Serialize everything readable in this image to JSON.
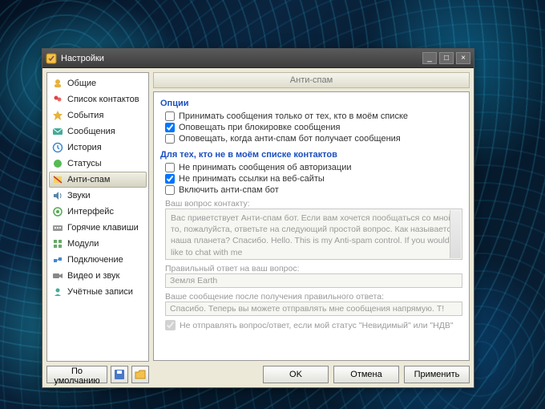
{
  "window": {
    "title": "Настройки"
  },
  "titlebar_buttons": {
    "min": "_",
    "max": "□",
    "close": "×"
  },
  "sidebar": {
    "items": [
      {
        "label": "Общие",
        "icon": "general"
      },
      {
        "label": "Список контактов",
        "icon": "contacts"
      },
      {
        "label": "События",
        "icon": "events"
      },
      {
        "label": "Сообщения",
        "icon": "messages"
      },
      {
        "label": "История",
        "icon": "history"
      },
      {
        "label": "Статусы",
        "icon": "status"
      },
      {
        "label": "Анти-спам",
        "icon": "antispam",
        "active": true
      },
      {
        "label": "Звуки",
        "icon": "sounds"
      },
      {
        "label": "Интерфейс",
        "icon": "interface"
      },
      {
        "label": "Горячие клавиши",
        "icon": "hotkeys"
      },
      {
        "label": "Модули",
        "icon": "modules"
      },
      {
        "label": "Подключение",
        "icon": "connection"
      },
      {
        "label": "Видео и звук",
        "icon": "av"
      },
      {
        "label": "Учётные записи",
        "icon": "accounts"
      }
    ],
    "default_button": "По умолчанию"
  },
  "panel": {
    "title": "Анти-спам",
    "group1": {
      "heading": "Опции",
      "opt1": {
        "label": "Принимать сообщения только от тех, кто в моём списке",
        "checked": false
      },
      "opt2": {
        "label": "Оповещать при блокировке сообщения",
        "checked": true
      },
      "opt3": {
        "label": "Оповещать, когда анти-спам бот получает сообщения",
        "checked": false
      }
    },
    "group2": {
      "heading": "Для тех, кто не в моём списке контактов",
      "opt1": {
        "label": "Не принимать сообщения об авторизации",
        "checked": false
      },
      "opt2": {
        "label": "Не принимать ссылки на веб-сайты",
        "checked": true
      },
      "opt3": {
        "label": "Включить анти-спам бот",
        "checked": false
      }
    },
    "bot": {
      "question_label": "Ваш вопрос контакту:",
      "question_text": "Вас приветствует Анти-спам бот. Если вам хочется пообщаться со мной, то, пожалуйста, ответьте на следующий простой вопрос. Как называется наша планета? Спасибо.\n\nHello. This is my Anti-spam control. If you would like to chat with me",
      "answer_label": "Правильный ответ на ваш вопрос:",
      "answer_value": "Земля Earth",
      "after_label": "Ваше сообщение после получения правильного ответа:",
      "after_value": "Спасибо. Теперь вы можете отправлять мне сообщения напрямую. T!",
      "skip": {
        "label": "Не отправлять вопрос/ответ, если мой статус \"Невидимый\" или \"НДВ\"",
        "checked": true
      }
    }
  },
  "footer": {
    "ok": "OK",
    "cancel": "Отмена",
    "apply": "Применить"
  }
}
